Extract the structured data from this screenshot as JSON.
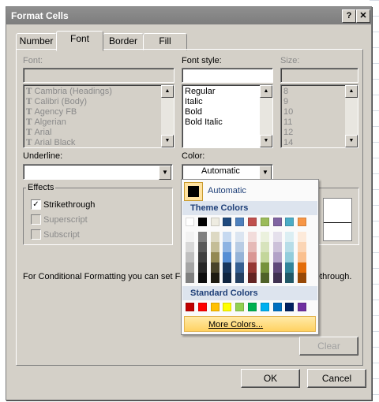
{
  "window": {
    "title": "Format Cells",
    "help_btn": "?",
    "close_btn": "✕"
  },
  "tabs": [
    {
      "label": "Number",
      "active": false
    },
    {
      "label": "Font",
      "active": true
    },
    {
      "label": "Border",
      "active": false
    },
    {
      "label": "Fill",
      "active": false
    }
  ],
  "font": {
    "label": "Font:",
    "value": "",
    "items": [
      "Cambria (Headings)",
      "Calibri (Body)",
      "Agency FB",
      "Algerian",
      "Arial",
      "Arial Black"
    ]
  },
  "font_style": {
    "label": "Font style:",
    "value": "",
    "items": [
      "Regular",
      "Italic",
      "Bold",
      "Bold Italic"
    ]
  },
  "size": {
    "label": "Size:",
    "value": "",
    "items": [
      "8",
      "9",
      "10",
      "11",
      "12",
      "14"
    ]
  },
  "underline": {
    "label": "Underline:",
    "value": ""
  },
  "color": {
    "label": "Color:",
    "value": "Automatic"
  },
  "effects": {
    "label": "Effects",
    "strikethrough": {
      "label": "Strikethrough",
      "checked": true
    },
    "superscript": {
      "label": "Superscript",
      "checked": false
    },
    "subscript": {
      "label": "Subscript",
      "checked": false
    }
  },
  "info_text_left": "For Conditional Formatting you can set Fo",
  "info_text_right": "ethrough.",
  "clear_button": "Clear",
  "ok_button": "OK",
  "cancel_button": "Cancel",
  "color_menu": {
    "automatic": "Automatic",
    "theme_header": "Theme Colors",
    "standard_header": "Standard Colors",
    "more_colors": "More Colors...",
    "theme_base": [
      "#ffffff",
      "#000000",
      "#eeece1",
      "#1f497d",
      "#4f81bd",
      "#c0504d",
      "#9bbb59",
      "#8064a2",
      "#4bacc6",
      "#f79646"
    ],
    "theme_shades": [
      [
        "#f2f2f2",
        "#d8d8d8",
        "#bfbfbf",
        "#a5a5a5",
        "#7f7f7f"
      ],
      [
        "#7f7f7f",
        "#595959",
        "#3f3f3f",
        "#262626",
        "#0c0c0c"
      ],
      [
        "#ddd9c3",
        "#c4bd97",
        "#938953",
        "#494429",
        "#1d1b10"
      ],
      [
        "#c6d9f0",
        "#8db3e2",
        "#548dd4",
        "#17365d",
        "#0f243e"
      ],
      [
        "#dbe5f1",
        "#b8cce4",
        "#95b3d7",
        "#366092",
        "#244061"
      ],
      [
        "#f2dcdb",
        "#e5b9b7",
        "#d99694",
        "#953734",
        "#632423"
      ],
      [
        "#ebf1dd",
        "#d7e3bc",
        "#c3d69b",
        "#76923c",
        "#4f6128"
      ],
      [
        "#e5e0ec",
        "#ccc1d9",
        "#b2a2c7",
        "#5f497a",
        "#3f3151"
      ],
      [
        "#dbeef3",
        "#b7dde8",
        "#92cddc",
        "#31859b",
        "#205867"
      ],
      [
        "#fdeada",
        "#fbd5b5",
        "#fac08f",
        "#e36c09",
        "#974806"
      ]
    ],
    "standard": [
      "#c00000",
      "#ff0000",
      "#ffc000",
      "#ffff00",
      "#92d050",
      "#00b050",
      "#00b0f0",
      "#0070c0",
      "#002060",
      "#7030a0"
    ]
  }
}
